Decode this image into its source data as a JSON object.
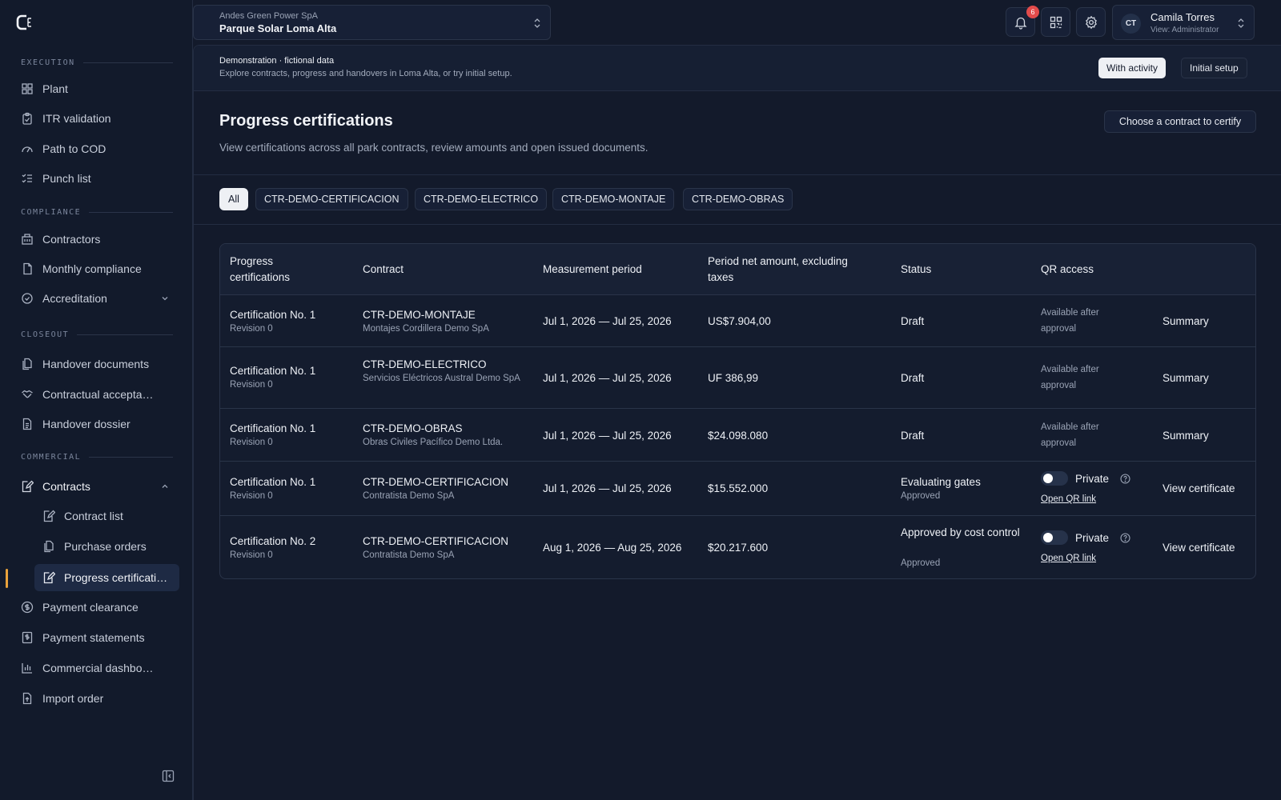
{
  "sidebar": {
    "sections": {
      "execution": "EXECUTION",
      "compliance": "COMPLIANCE",
      "closeout": "CLOSEOUT",
      "commercial": "COMMERCIAL"
    },
    "items": {
      "plant": "Plant",
      "itr": "ITR validation",
      "path": "Path to COD",
      "punch": "Punch list",
      "contractors": "Contractors",
      "monthly": "Monthly compliance",
      "accreditation": "Accreditation",
      "handover_docs": "Handover documents",
      "acceptance": "Contractual acceptance",
      "dossier": "Handover dossier",
      "contracts": "Contracts",
      "contract_list": "Contract list",
      "purchase_orders": "Purchase orders",
      "progress_cert": "Progress certifications",
      "payment_clearance": "Payment clearance",
      "payment_statements": "Payment statements",
      "dashboard": "Commercial dashboard",
      "import_order": "Import order"
    },
    "active_accent": "#e9a23b"
  },
  "topbar": {
    "org": "Andes Green Power SpA",
    "project": "Parque Solar Loma Alta",
    "notifications_count": "6",
    "user_initials": "CT",
    "user_name": "Camila Torres",
    "user_role": "View: Administrator"
  },
  "demo": {
    "title": "Demonstration · fictional data",
    "subtitle": "Explore contracts, progress and handovers in Loma Alta, or try initial setup.",
    "btn_activity": "With activity",
    "btn_setup": "Initial setup"
  },
  "page": {
    "title": "Progress certifications",
    "subtitle": "View certifications across all park contracts, review amounts and open issued documents.",
    "choose_btn": "Choose a contract to certify"
  },
  "filters": [
    "All",
    "CTR-DEMO-CERTIFICACION",
    "CTR-DEMO-ELECTRICO",
    "CTR-DEMO-MONTAJE",
    "CTR-DEMO-OBRAS"
  ],
  "table": {
    "headers": {
      "cert": "Progress certifications",
      "contract": "Contract",
      "period": "Measurement period",
      "amount": "Period net amount, excluding taxes",
      "status": "Status",
      "qr": "QR access"
    },
    "rows": [
      {
        "cert": "Certification No. 1",
        "rev": "Revision 0",
        "contract": "CTR-DEMO-MONTAJE",
        "contractor": "Montajes Cordillera Demo SpA",
        "period": "Jul 1, 2026 — Jul 25, 2026",
        "amount": "US$7.904,00",
        "status": "Draft",
        "status_sub": "",
        "qr_note": "Available after approval",
        "qr_private": "",
        "qr_link": "",
        "action": "Summary"
      },
      {
        "cert": "Certification No. 1",
        "rev": "Revision 0",
        "contract": "CTR-DEMO-ELECTRICO",
        "contractor": "Servicios Eléctricos Austral Demo SpA",
        "period": "Jul 1, 2026 — Jul 25, 2026",
        "amount": "UF 386,99",
        "status": "Draft",
        "status_sub": "",
        "qr_note": "Available after approval",
        "qr_private": "",
        "qr_link": "",
        "action": "Summary"
      },
      {
        "cert": "Certification No. 1",
        "rev": "Revision 0",
        "contract": "CTR-DEMO-OBRAS",
        "contractor": "Obras Civiles Pacífico Demo Ltda.",
        "period": "Jul 1, 2026 — Jul 25, 2026",
        "amount": "$24.098.080",
        "status": "Draft",
        "status_sub": "",
        "qr_note": "Available after approval",
        "qr_private": "",
        "qr_link": "",
        "action": "Summary"
      },
      {
        "cert": "Certification No. 1",
        "rev": "Revision 0",
        "contract": "CTR-DEMO-CERTIFICACION",
        "contractor": "Contratista Demo SpA",
        "period": "Jul 1, 2026 — Jul 25, 2026",
        "amount": "$15.552.000",
        "status": "Evaluating gates",
        "status_sub": "Approved",
        "qr_note": "",
        "qr_private": "Private",
        "qr_link": "Open QR link",
        "action": "View certificate"
      },
      {
        "cert": "Certification No. 2",
        "rev": "Revision 0",
        "contract": "CTR-DEMO-CERTIFICACION",
        "contractor": "Contratista Demo SpA",
        "period": "Aug 1, 2026 — Aug 25, 2026",
        "amount": "$20.217.600",
        "status": "Approved by cost control",
        "status_sub": "Approved",
        "qr_note": "",
        "qr_private": "Private",
        "qr_link": "Open QR link",
        "action": "View certificate"
      }
    ]
  }
}
